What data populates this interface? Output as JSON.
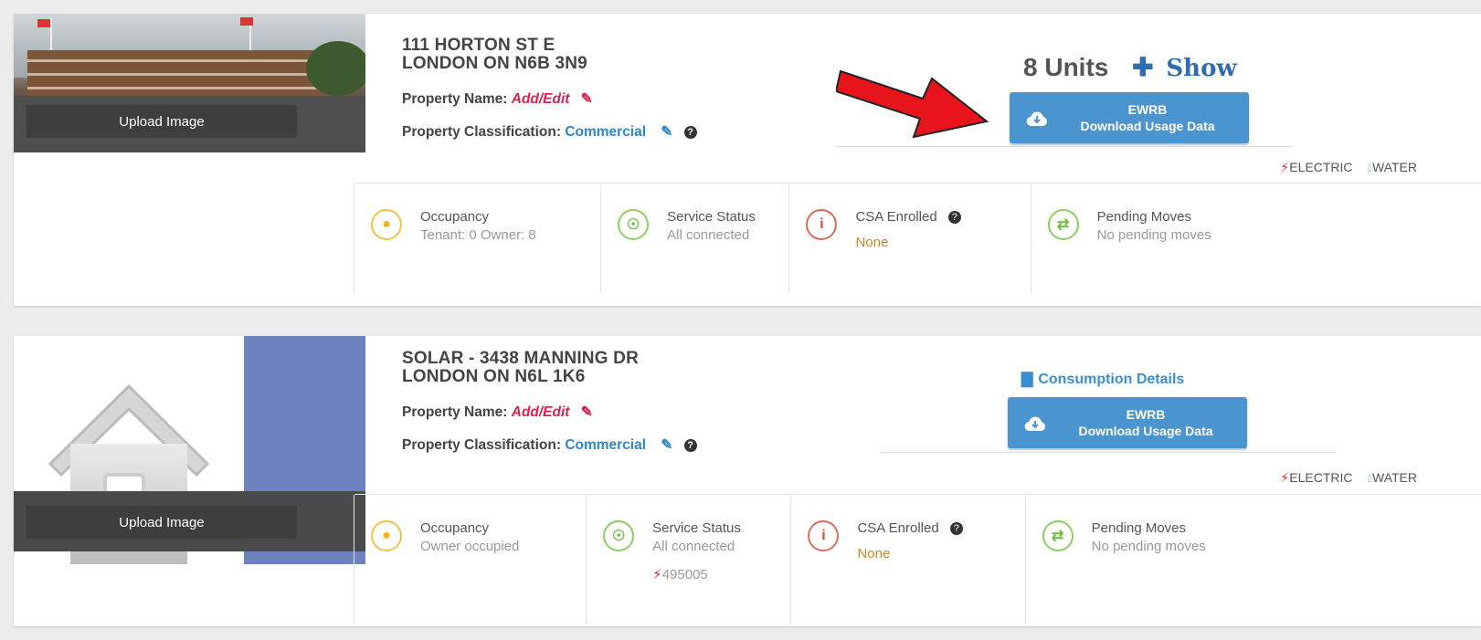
{
  "properties": [
    {
      "address_line1": "111 HORTON ST E",
      "address_line2": "LONDON ON  N6B 3N9",
      "upload_label": "Upload Image",
      "property_name_label": "Property Name:",
      "property_name_value": "Add/Edit",
      "property_class_label": "Property Classification:",
      "property_class_value": "Commercial",
      "units_label": "8 Units",
      "show_label": "Show",
      "ewrb_title": "EWRB",
      "ewrb_subtitle": "Download Usage Data",
      "electric_label": "ELECTRIC",
      "water_label": "WATER",
      "occupancy_label": "Occupancy",
      "occupancy_value": "Tenant: 0 Owner: 8",
      "service_label": "Service Status",
      "service_value": "All connected",
      "csa_label": "CSA Enrolled",
      "csa_value": "None",
      "moves_label": "Pending Moves",
      "moves_value": "No pending moves"
    },
    {
      "address_line1": "SOLAR -  3438 MANNING DR",
      "address_line2": "LONDON ON  N6L 1K6",
      "upload_label": "Upload Image",
      "property_name_label": "Property Name:",
      "property_name_value": "Add/Edit",
      "property_class_label": "Property Classification:",
      "property_class_value": "Commercial",
      "consumption_label": "Consumption Details",
      "ewrb_title": "EWRB",
      "ewrb_subtitle": "Download Usage Data",
      "electric_label": "ELECTRIC",
      "water_label": "WATER",
      "occupancy_label": "Occupancy",
      "occupancy_value": "Owner occupied",
      "service_label": "Service Status",
      "service_value": "All connected",
      "service_extra": "495005",
      "csa_label": "CSA Enrolled",
      "csa_value": "None",
      "moves_label": "Pending Moves",
      "moves_value": "No pending moves"
    }
  ],
  "icons": {
    "help": "question-circle-icon",
    "edit": "edit-icon",
    "cloud": "cloud-download-icon",
    "electric": "bolt-icon",
    "water": "drop-icon",
    "chart": "bar-chart-icon"
  },
  "colors": {
    "accent_blue": "#4a94d0",
    "link_red": "#d8234e",
    "annotation_arrow": "#e8141b"
  }
}
